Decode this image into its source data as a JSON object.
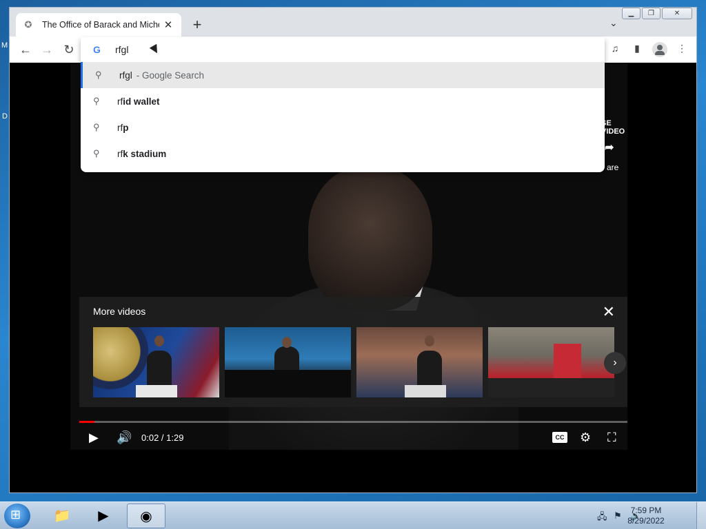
{
  "desktop": {
    "fragment_left_top": "M",
    "fragment_left_mid": "D"
  },
  "tab": {
    "title": "The Office of Barack and Michelle Obama",
    "close_glyph": "✕",
    "new_tab_glyph": "+",
    "tab_search_glyph": "⌄"
  },
  "window_controls": {
    "minimize": "▁",
    "restore": "❐",
    "close": "✕"
  },
  "toolbar": {
    "back": "←",
    "forward": "→",
    "reload": "↻",
    "media": "♫",
    "side_panel": "▮",
    "menu": "⋮"
  },
  "omnibox": {
    "google_glyph": "G",
    "value": "rfgl",
    "suggestions": [
      {
        "prefix": "rfgl",
        "bold": "",
        "sub": "- Google Search",
        "selected": true
      },
      {
        "prefix": "rf",
        "bold": "id wallet",
        "sub": "",
        "selected": false
      },
      {
        "prefix": "rf",
        "bold": "p",
        "sub": "",
        "selected": false
      },
      {
        "prefix": "rf",
        "bold": "k stadium",
        "sub": "",
        "selected": false
      }
    ]
  },
  "video": {
    "overlay_label_partial": "SE VIDEO",
    "share_partial": "are",
    "more_videos_title": "More videos",
    "close_glyph": "✕",
    "next_glyph": "›",
    "time": "0:02 / 1:29",
    "progress_fraction": 0.028,
    "cc_label": "CC",
    "play_glyph": "▶",
    "volume_glyph": "🔊",
    "settings_glyph": "⚙",
    "fullscreen_glyph": "⛶",
    "share_glyph": "➦"
  },
  "taskbar": {
    "clock_time": "7:59 PM",
    "clock_date": "8/29/2022"
  },
  "colors": {
    "accent_blue": "#1a73e8",
    "progress_red": "#ff0000"
  }
}
